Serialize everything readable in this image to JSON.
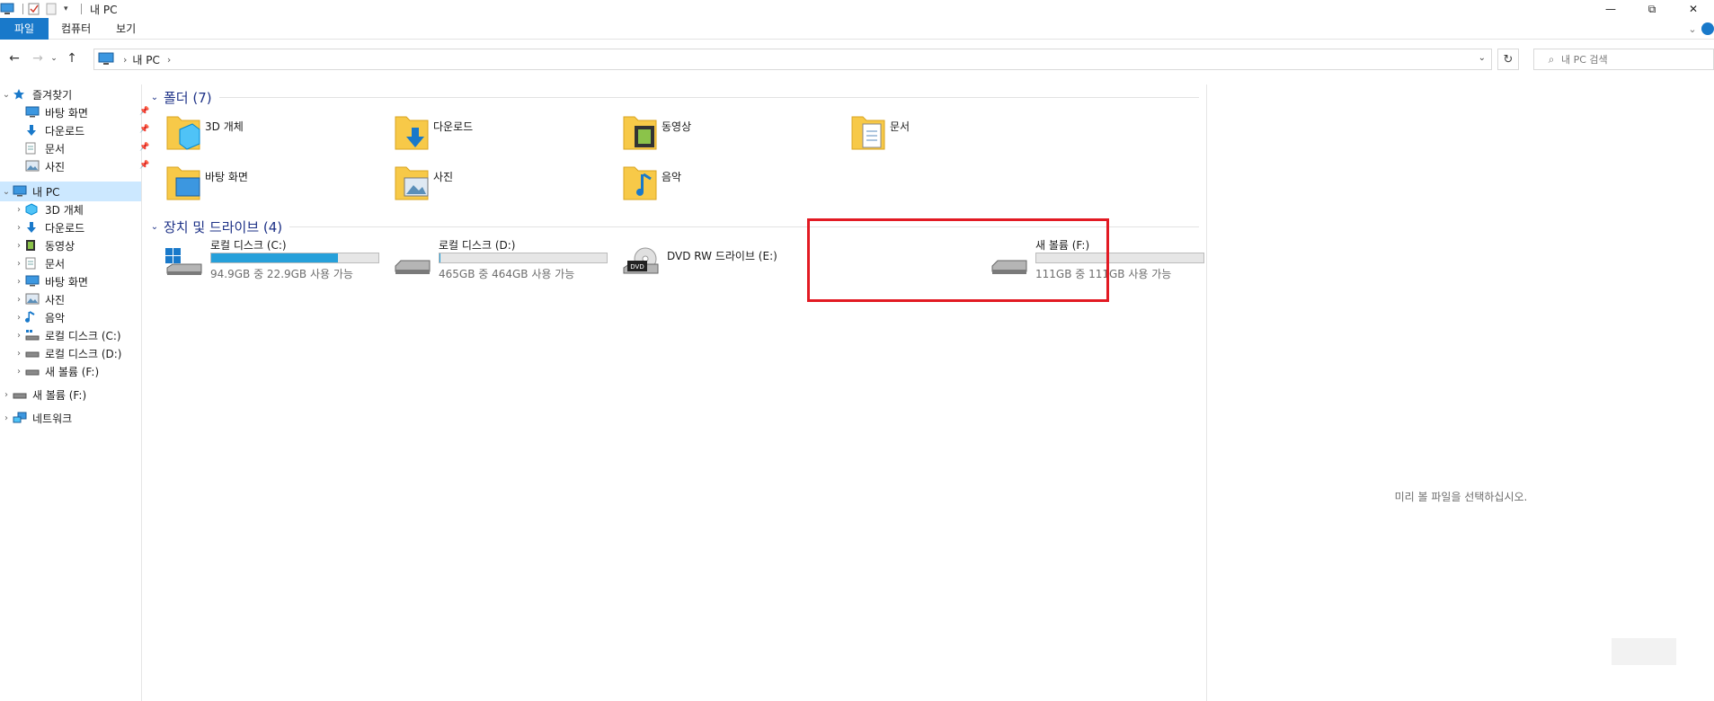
{
  "window": {
    "title": "내 PC",
    "controls": {
      "minimize": "—",
      "restore": "⧉",
      "close": "✕"
    }
  },
  "ribbon": {
    "tabs": [
      {
        "label": "파일",
        "active": true
      },
      {
        "label": "컴퓨터",
        "active": false
      },
      {
        "label": "보기",
        "active": false
      }
    ],
    "expand_icon": "chevron-down-icon",
    "help_icon": "help-icon"
  },
  "address": {
    "crumbs": [
      "내 PC"
    ],
    "separator": "›",
    "search_placeholder": "내 PC 검색"
  },
  "nav": {
    "quick_access": {
      "label": "즐겨찾기",
      "items": [
        {
          "label": "바탕 화면",
          "icon": "desktop-icon",
          "pinned": true
        },
        {
          "label": "다운로드",
          "icon": "download-icon",
          "pinned": true
        },
        {
          "label": "문서",
          "icon": "document-icon",
          "pinned": true
        },
        {
          "label": "사진",
          "icon": "pictures-icon",
          "pinned": true
        }
      ]
    },
    "this_pc": {
      "label": "내 PC",
      "selected": true,
      "items": [
        {
          "label": "3D 개체",
          "icon": "3d-objects-icon"
        },
        {
          "label": "다운로드",
          "icon": "download-icon"
        },
        {
          "label": "동영상",
          "icon": "videos-icon"
        },
        {
          "label": "문서",
          "icon": "document-icon"
        },
        {
          "label": "바탕 화면",
          "icon": "desktop-icon"
        },
        {
          "label": "사진",
          "icon": "pictures-icon"
        },
        {
          "label": "음악",
          "icon": "music-icon"
        },
        {
          "label": "로컬 디스크 (C:)",
          "icon": "drive-c-icon"
        },
        {
          "label": "로컬 디스크 (D:)",
          "icon": "drive-icon"
        },
        {
          "label": "새 볼륨 (F:)",
          "icon": "drive-icon"
        }
      ]
    },
    "extra": [
      {
        "label": "새 볼륨 (F:)",
        "icon": "drive-icon"
      },
      {
        "label": "네트워크",
        "icon": "network-icon"
      }
    ]
  },
  "content": {
    "folders_group": "폴더 (7)",
    "folders": [
      {
        "label": "3D 개체",
        "icon": "3d-objects-folder-icon"
      },
      {
        "label": "다운로드",
        "icon": "downloads-folder-icon"
      },
      {
        "label": "동영상",
        "icon": "videos-folder-icon"
      },
      {
        "label": "문서",
        "icon": "documents-folder-icon"
      },
      {
        "label": "바탕 화면",
        "icon": "desktop-folder-icon"
      },
      {
        "label": "사진",
        "icon": "pictures-folder-icon"
      },
      {
        "label": "음악",
        "icon": "music-folder-icon"
      }
    ],
    "drives_group": "장치 및 드라이브 (4)",
    "drives": [
      {
        "label": "로컬 디스크 (C:)",
        "size": "94.9GB 중 22.9GB 사용 가능",
        "used_fraction": 0.76,
        "icon": "windows-drive-icon",
        "has_bar": true
      },
      {
        "label": "로컬 디스크 (D:)",
        "size": "465GB 중 464GB 사용 가능",
        "used_fraction": 0.002,
        "icon": "hard-drive-icon",
        "has_bar": true
      },
      {
        "label": "DVD RW 드라이브 (E:)",
        "size": "",
        "icon": "dvd-drive-icon",
        "has_bar": false
      },
      {
        "label": "새 볼륨 (F:)",
        "size": "111GB 중 111GB 사용 가능",
        "used_fraction": 0.0,
        "icon": "hard-drive-icon",
        "has_bar": true
      }
    ]
  },
  "preview": {
    "message": "미리 볼 파일을 선택하십시오."
  },
  "colors": {
    "accent": "#1979ca",
    "group_title": "#1e3287",
    "selection": "#cce8ff",
    "drive_fill": "#26a0da",
    "highlight": "#e21a23"
  }
}
